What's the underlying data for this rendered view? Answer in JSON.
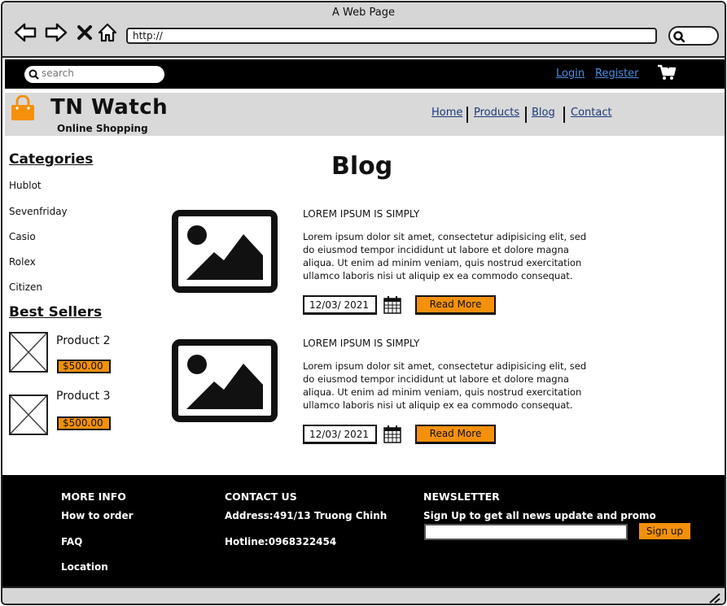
{
  "window": {
    "title": "A Web Page",
    "url": "http://"
  },
  "topbar": {
    "search_placeholder": "search",
    "login": "Login",
    "register": "Register"
  },
  "header": {
    "brand": "TN Watch",
    "tagline": "Online Shopping",
    "nav": [
      "Home",
      "Products",
      "Blog",
      "Contact"
    ]
  },
  "sidebar": {
    "categories_title": "Categories",
    "categories": [
      "Hublot",
      "Sevenfriday",
      "Casio",
      "Rolex",
      "Citizen"
    ],
    "bestsellers_title": "Best Sellers",
    "products": [
      {
        "name": "Product 2",
        "price": "$500.00"
      },
      {
        "name": "Product 3",
        "price": "$500.00"
      }
    ]
  },
  "main": {
    "title": "Blog",
    "posts": [
      {
        "title": "LOREM IPSUM IS SIMPLY",
        "body": "Lorem ipsum dolor sit amet, consectetur adipisicing elit, sed do eiusmod tempor incididunt ut labore et dolore magna aliqua. Ut enim ad minim veniam, quis nostrud exercitation ullamco laboris nisi ut aliquip ex ea commodo consequat.",
        "date": "12/03/ 2021",
        "button": "Read More"
      },
      {
        "title": "LOREM IPSUM IS SIMPLY",
        "body": "Lorem ipsum dolor sit amet, consectetur adipisicing elit, sed do eiusmod tempor incididunt ut labore et dolore magna aliqua. Ut enim ad minim veniam, quis nostrud exercitation ullamco laboris nisi ut aliquip ex ea commodo consequat.",
        "date": "12/03/ 2021",
        "button": "Read More"
      }
    ]
  },
  "footer": {
    "more_info_title": "MORE INFO",
    "more_info": [
      "How to order",
      "FAQ",
      "Location"
    ],
    "contact_title": "CONTACT US",
    "address": "Address:491/13 Truong Chinh",
    "hotline": "Hotline:0968322454",
    "newsletter_title": "NEWSLETTER",
    "newsletter_text": "Sign Up to get all news update and promo",
    "signup": "Sign up"
  },
  "colors": {
    "accent": "#f4900c",
    "dark": "#000000",
    "chrome": "#d6d6d6",
    "link": "#4a90e2"
  },
  "icons": [
    "back-arrow-icon",
    "forward-arrow-icon",
    "close-icon",
    "home-icon",
    "search-icon",
    "cart-icon",
    "shopping-bag-icon",
    "image-placeholder-icon",
    "calendar-icon",
    "resize-grip-icon"
  ]
}
